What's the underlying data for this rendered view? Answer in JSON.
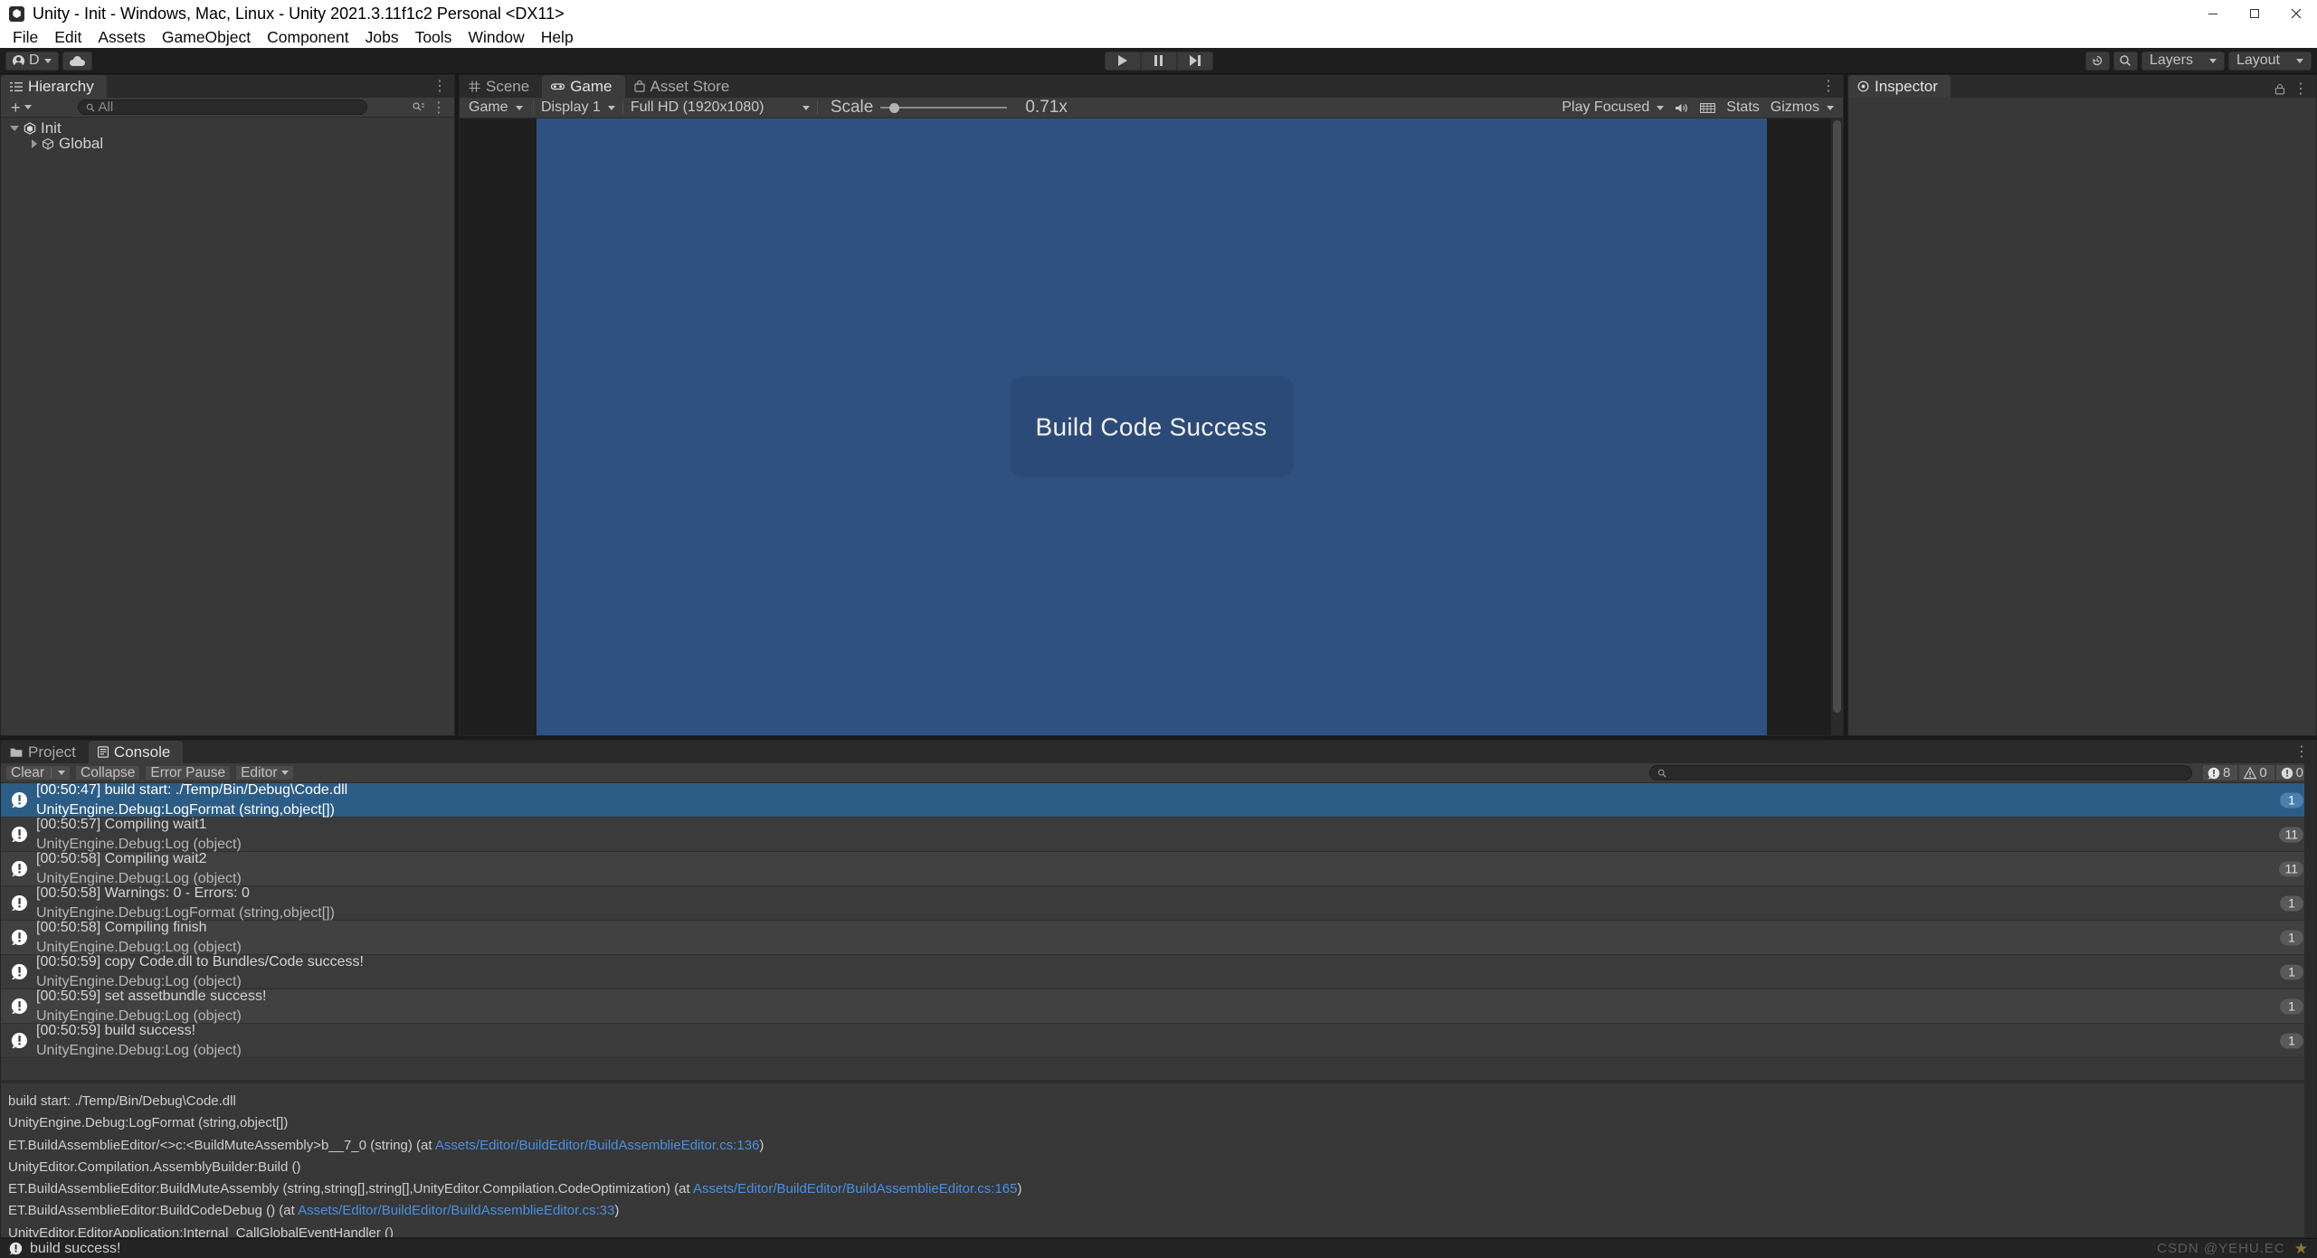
{
  "window": {
    "title": "Unity - Init - Windows, Mac, Linux - Unity 2021.3.11f1c2 Personal <DX11>",
    "minimize": "–",
    "maximize": "❐",
    "close": "✕"
  },
  "menubar": {
    "items": [
      "File",
      "Edit",
      "Assets",
      "GameObject",
      "Component",
      "Jobs",
      "Tools",
      "Window",
      "Help"
    ]
  },
  "toolbar": {
    "account_label": "D",
    "cloud_icon": "cloud-icon",
    "play_icon": "play-icon",
    "pause_icon": "pause-icon",
    "step_icon": "step-icon",
    "undo_history_icon": "undo-history-icon",
    "search_icon": "search-icon",
    "layers_label": "Layers",
    "layout_label": "Layout"
  },
  "hierarchy": {
    "tab_label": "Hierarchy",
    "add_label": "+",
    "search_placeholder": "All",
    "items": [
      {
        "label": "Init",
        "icon": "unity-scene-icon",
        "expanded": true,
        "depth": 0
      },
      {
        "label": "Global",
        "icon": "gameobject-cube-icon",
        "expanded": false,
        "depth": 1
      }
    ]
  },
  "gameview": {
    "tabs": [
      {
        "label": "Scene",
        "icon": "grid-icon",
        "active": false
      },
      {
        "label": "Game",
        "icon": "gamepad-icon",
        "active": true
      },
      {
        "label": "Asset Store",
        "icon": "store-bag-icon",
        "active": false
      }
    ],
    "display_mode": "Game",
    "display_number": "Display 1",
    "resolution": "Full HD (1920x1080)",
    "scale_label": "Scale",
    "scale_value": "0.71x",
    "scale_percent": 8,
    "play_mode": "Play Focused",
    "mute_icon": "mute-audio-icon",
    "stats_grid_icon": "stats-grid-icon",
    "stats_label": "Stats",
    "gizmos_label": "Gizmos",
    "canvas_text": "Build Code Success",
    "canvas_bg_color": "#2f5182",
    "panel_bg_color": "#2c4a77"
  },
  "inspector": {
    "tab_label": "Inspector",
    "lock_icon": "lock-icon"
  },
  "console": {
    "tabs": [
      {
        "label": "Project",
        "icon": "folder-icon",
        "active": false
      },
      {
        "label": "Console",
        "icon": "console-icon",
        "active": true
      }
    ],
    "clear_label": "Clear",
    "collapse_label": "Collapse",
    "error_pause_label": "Error Pause",
    "editor_label": "Editor",
    "search_placeholder": "",
    "counts": {
      "log": "8",
      "warning": "0",
      "error": "0"
    },
    "entries": [
      {
        "line1": "[00:50:47] build start:  ./Temp/Bin/Debug\\Code.dll",
        "line2": "UnityEngine.Debug:LogFormat (string,object[])",
        "count": "1",
        "selected": true
      },
      {
        "line1": "[00:50:57] Compiling wait1",
        "line2": "UnityEngine.Debug:Log (object)",
        "count": "11",
        "selected": false
      },
      {
        "line1": "[00:50:58] Compiling wait2",
        "line2": "UnityEngine.Debug:Log (object)",
        "count": "11",
        "selected": false
      },
      {
        "line1": "[00:50:58] Warnings: 0 - Errors: 0",
        "line2": "UnityEngine.Debug:LogFormat (string,object[])",
        "count": "1",
        "selected": false
      },
      {
        "line1": "[00:50:58] Compiling finish",
        "line2": "UnityEngine.Debug:Log (object)",
        "count": "1",
        "selected": false
      },
      {
        "line1": "[00:50:59] copy Code.dll to Bundles/Code success!",
        "line2": "UnityEngine.Debug:Log (object)",
        "count": "1",
        "selected": false
      },
      {
        "line1": "[00:50:59] set assetbundle success!",
        "line2": "UnityEngine.Debug:Log (object)",
        "count": "1",
        "selected": false
      },
      {
        "line1": "[00:50:59] build success!",
        "line2": "UnityEngine.Debug:Log (object)",
        "count": "1",
        "selected": false
      }
    ],
    "detail": [
      {
        "text": "build start:  ./Temp/Bin/Debug\\Code.dll",
        "link": ""
      },
      {
        "text": "UnityEngine.Debug:LogFormat (string,object[])",
        "link": ""
      },
      {
        "text": "ET.BuildAssemblieEditor/<>c:<BuildMuteAssembly>b__7_0 (string) (at ",
        "link": "Assets/Editor/BuildEditor/BuildAssemblieEditor.cs:136",
        "suffix": ")"
      },
      {
        "text": "UnityEditor.Compilation.AssemblyBuilder:Build ()",
        "link": ""
      },
      {
        "text": "ET.BuildAssemblieEditor:BuildMuteAssembly (string,string[],string[],UnityEditor.Compilation.CodeOptimization) (at ",
        "link": "Assets/Editor/BuildEditor/BuildAssemblieEditor.cs:165",
        "suffix": ")"
      },
      {
        "text": "ET.BuildAssemblieEditor:BuildCodeDebug () (at ",
        "link": "Assets/Editor/BuildEditor/BuildAssemblieEditor.cs:33",
        "suffix": ")"
      },
      {
        "text": "UnityEditor.EditorApplication:Internal_CallGlobalEventHandler ()",
        "link": ""
      }
    ]
  },
  "statusbar": {
    "message": "build success!",
    "watermark": "CSDN @YEHU.EC"
  }
}
